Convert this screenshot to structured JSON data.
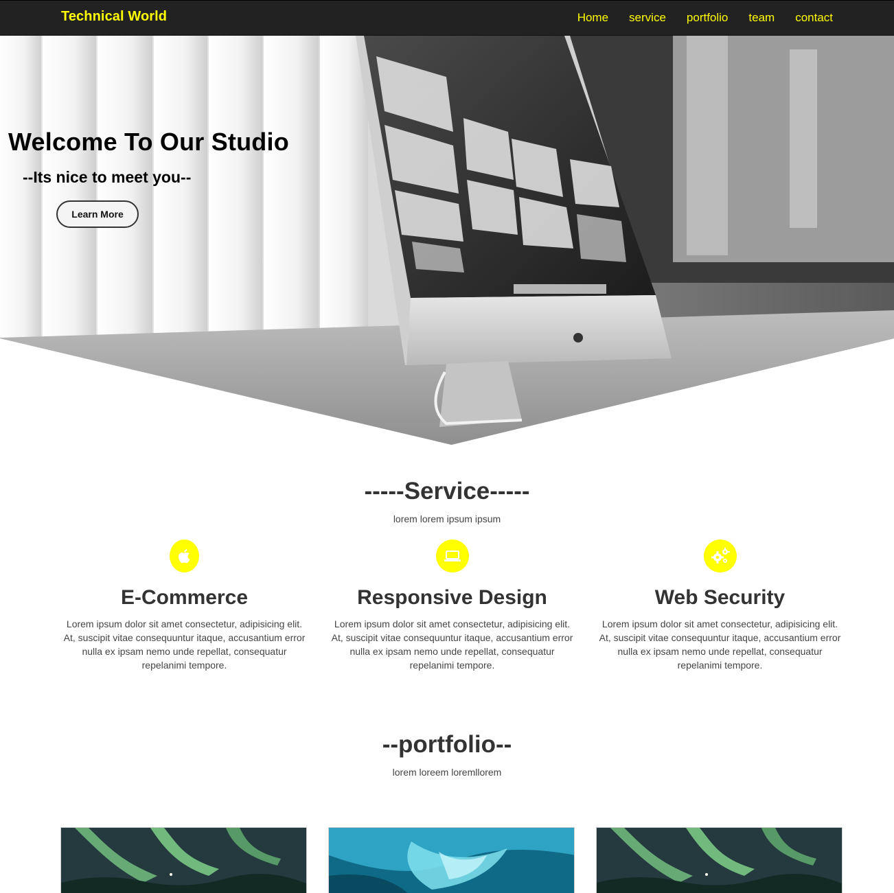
{
  "nav": {
    "brand": "Technical World",
    "links": [
      "Home",
      "service",
      "portfolio",
      "team",
      "contact"
    ]
  },
  "hero": {
    "title": "Welcome To Our Studio",
    "subtitle": "--Its nice to meet you--",
    "button_label": "Learn More"
  },
  "service": {
    "title": "-----Service-----",
    "subtitle": "lorem lorem ipsum ipsum",
    "items": [
      {
        "icon": "apple-icon",
        "title": "E-Commerce",
        "text": "Lorem ipsum dolor sit amet consectetur, adipisicing elit. At, suscipit vitae consequuntur itaque, accusantium error nulla ex ipsam nemo unde repellat, consequatur repelanimi tempore."
      },
      {
        "icon": "laptop-icon",
        "title": "Responsive Design",
        "text": "Lorem ipsum dolor sit amet consectetur, adipisicing elit. At, suscipit vitae consequuntur itaque, accusantium error nulla ex ipsam nemo unde repellat, consequatur repelanimi tempore."
      },
      {
        "icon": "gears-icon",
        "title": "Web Security",
        "text": "Lorem ipsum dolor sit amet consectetur, adipisicing elit. At, suscipit vitae consequuntur itaque, accusantium error nulla ex ipsam nemo unde repellat, consequatur repelanimi tempore."
      }
    ]
  },
  "portfolio": {
    "title": "--portfolio--",
    "subtitle": "lorem loreem loremllorem",
    "images": [
      "aurora-image",
      "ice-cave-image",
      "aurora-image"
    ]
  },
  "colors": {
    "accent": "#ffff00",
    "nav_bg": "#222222",
    "text": "#333333"
  }
}
